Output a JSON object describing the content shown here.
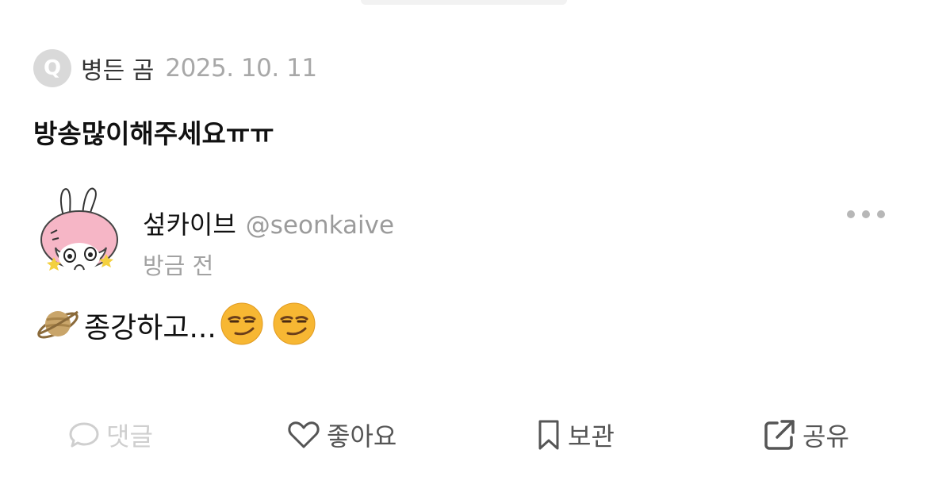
{
  "question": {
    "badge": "Q",
    "author": "병든 곰",
    "date": "2025. 10. 11",
    "text": "방송많이해주세요ㅠㅠ"
  },
  "answer": {
    "display_name": "섶카이브",
    "handle": "@seonkaive",
    "time": "방금 전",
    "text": "종강하고...",
    "leading_emoji": "ringed-planet",
    "trailing_emojis": [
      "smirking-face",
      "smirking-face"
    ]
  },
  "actions": {
    "comment": "댓글",
    "like": "좋아요",
    "save": "보관",
    "share": "공유"
  },
  "colors": {
    "muted_text": "#a8a8a8",
    "disabled_text": "#cfcfcf",
    "action_text": "#555555"
  }
}
